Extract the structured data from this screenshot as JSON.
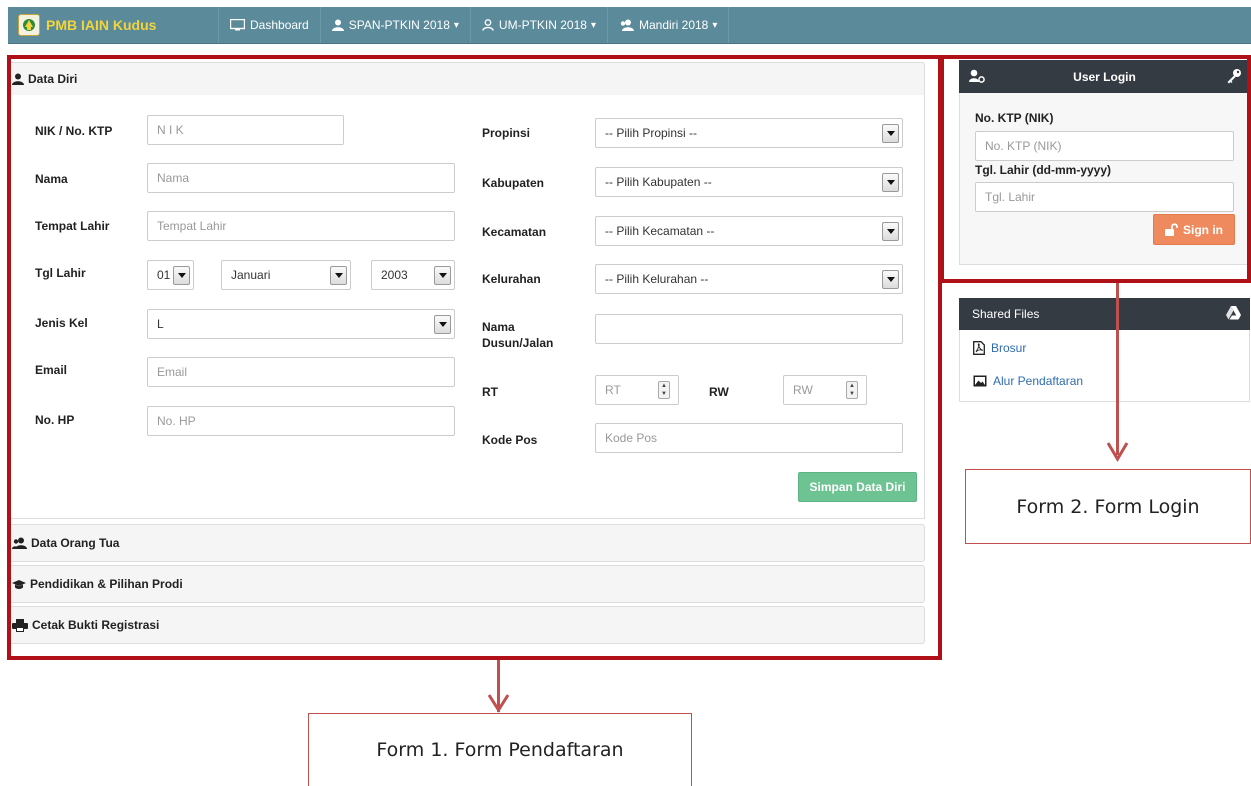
{
  "navbar": {
    "brand": "PMB IAIN Kudus",
    "items": [
      {
        "label": "Dashboard",
        "icon": "monitor-icon",
        "caret": ""
      },
      {
        "label": "SPAN-PTKIN 2018",
        "icon": "user-icon",
        "caret": "▾"
      },
      {
        "label": "UM-PTKIN 2018",
        "icon": "user-outline-icon",
        "caret": "▾"
      },
      {
        "label": "Mandiri 2018",
        "icon": "users-icon",
        "caret": "▾"
      }
    ]
  },
  "accordion": {
    "data_diri": "Data Diri",
    "orang_tua": "Data Orang Tua",
    "pendidikan": "Pendidikan & Pilihan Prodi",
    "cetak": "Cetak Bukti Registrasi"
  },
  "form": {
    "nik_label": "NIK / No. KTP",
    "nik_placeholder": "N I K",
    "nama_label": "Nama",
    "nama_placeholder": "Nama",
    "tempat_label": "Tempat Lahir",
    "tempat_placeholder": "Tempat Lahir",
    "tgl_label": "Tgl Lahir",
    "tgl_day": "01",
    "tgl_month": "Januari",
    "tgl_year": "2003",
    "jk_label": "Jenis Kel",
    "jk_value": "L",
    "email_label": "Email",
    "email_placeholder": "Email",
    "hp_label": "No. HP",
    "hp_placeholder": "No. HP",
    "propinsi_label": "Propinsi",
    "propinsi_value": "-- Pilih Propinsi --",
    "kabupaten_label": "Kabupaten",
    "kabupaten_value": "-- Pilih Kabupaten --",
    "kecamatan_label": "Kecamatan",
    "kecamatan_value": "-- Pilih Kecamatan --",
    "kelurahan_label": "Kelurahan",
    "kelurahan_value": "-- Pilih Kelurahan --",
    "dusun_label_1": "Nama",
    "dusun_label_2": "Dusun/Jalan",
    "dusun_value": "",
    "rt_label": "RT",
    "rt_placeholder": "RT",
    "rw_label": "RW",
    "rw_placeholder": "RW",
    "kodepos_label": "Kode Pos",
    "kodepos_placeholder": "Kode Pos",
    "save_button": "Simpan Data Diri"
  },
  "login": {
    "title": "User Login",
    "ktp_label": "No. KTP (NIK)",
    "ktp_placeholder": "No. KTP (NIK)",
    "tgl_label": "Tgl. Lahir (dd-mm-yyyy)",
    "tgl_placeholder": "Tgl. Lahir",
    "signin_button": "Sign in"
  },
  "files": {
    "title": "Shared Files",
    "items": [
      "Brosur",
      "Alur Pendaftaran"
    ]
  },
  "annotations": {
    "form1": "Form 1. Form Pendaftaran",
    "form2": "Form 2. Form Login"
  },
  "colors": {
    "navbar": "#5b8a9a",
    "brand_text": "#f2d43b",
    "highlight_border": "#b01018",
    "save_button": "#6ec392",
    "signin_button": "#ee8a5d",
    "panel_header": "#353b43",
    "link": "#2f6db0"
  }
}
